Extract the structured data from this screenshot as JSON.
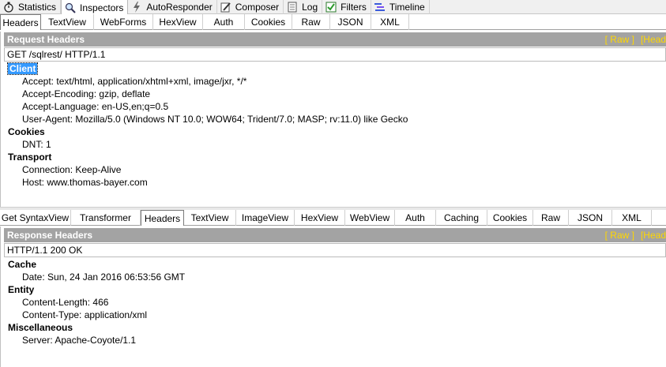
{
  "top_tabs": [
    {
      "label": "Statistics",
      "icon": "stopwatch-icon"
    },
    {
      "label": "Inspectors",
      "icon": "magnifier-icon"
    },
    {
      "label": "AutoResponder",
      "icon": "lightning-icon"
    },
    {
      "label": "Composer",
      "icon": "pencil-icon"
    },
    {
      "label": "Log",
      "icon": "document-icon"
    },
    {
      "label": "Filters",
      "icon": "checkbox-icon"
    },
    {
      "label": "Timeline",
      "icon": "timeline-icon"
    }
  ],
  "request_tabs": [
    "Headers",
    "TextView",
    "WebForms",
    "HexView",
    "Auth",
    "Cookies",
    "Raw",
    "JSON",
    "XML"
  ],
  "request": {
    "title": "Request Headers",
    "raw_link": "[ Raw ]",
    "header_link": "[Head",
    "line": "GET /sqlrest/ HTTP/1.1",
    "groups": [
      {
        "name": "Client",
        "items": [
          "Accept: text/html, application/xhtml+xml, image/jxr, */*",
          "Accept-Encoding: gzip, deflate",
          "Accept-Language: en-US,en;q=0.5",
          "User-Agent: Mozilla/5.0 (Windows NT 10.0; WOW64; Trident/7.0; MASP; rv:11.0) like Gecko"
        ]
      },
      {
        "name": "Cookies",
        "items": [
          "DNT: 1"
        ]
      },
      {
        "name": "Transport",
        "items": [
          "Connection: Keep-Alive",
          "Host: www.thomas-bayer.com"
        ]
      }
    ]
  },
  "response_tabs": [
    "Get SyntaxView",
    "Transformer",
    "Headers",
    "TextView",
    "ImageView",
    "HexView",
    "WebView",
    "Auth",
    "Caching",
    "Cookies",
    "Raw",
    "JSON",
    "XML"
  ],
  "response": {
    "title": "Response Headers",
    "raw_link": "[ Raw ]",
    "header_link": "[Head",
    "line": "HTTP/1.1 200 OK",
    "groups": [
      {
        "name": "Cache",
        "items": [
          "Date: Sun, 24 Jan 2016 06:53:56 GMT"
        ]
      },
      {
        "name": "Entity",
        "items": [
          "Content-Length: 466",
          "Content-Type: application/xml"
        ]
      },
      {
        "name": "Miscellaneous",
        "items": [
          "Server: Apache-Coyote/1.1"
        ]
      }
    ]
  },
  "colors": {
    "selection": "#3399ff",
    "panel_header": "#a3a3a3",
    "link": "#ffd700"
  }
}
